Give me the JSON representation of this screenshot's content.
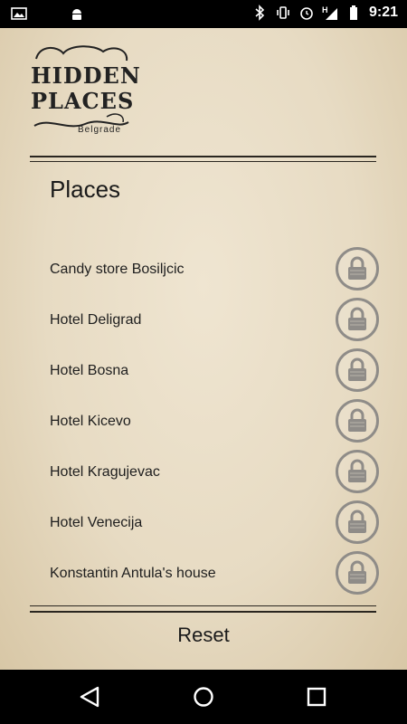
{
  "status_bar": {
    "time": "9:21",
    "icons": [
      "image-icon",
      "android-icon",
      "bluetooth-icon",
      "vibrate-icon",
      "alarm-icon",
      "hspa-signal-icon",
      "battery-icon"
    ]
  },
  "logo": {
    "line1": "HIDDEN",
    "line2": "PLACES",
    "city": "Belgrade"
  },
  "section_title": "Places",
  "places": [
    {
      "name": "Candy store Bosiljcic",
      "icon": "lock-icon"
    },
    {
      "name": "Hotel Deligrad",
      "icon": "lock-icon"
    },
    {
      "name": "Hotel Bosna",
      "icon": "lock-icon"
    },
    {
      "name": "Hotel Kicevo",
      "icon": "lock-icon"
    },
    {
      "name": "Hotel Kragujevac",
      "icon": "lock-icon"
    },
    {
      "name": "Hotel Venecija",
      "icon": "lock-icon"
    },
    {
      "name": "Konstantin Antula's house",
      "icon": "lock-icon"
    }
  ],
  "reset_label": "Reset",
  "nav": [
    "back-icon",
    "home-icon",
    "recents-icon"
  ]
}
